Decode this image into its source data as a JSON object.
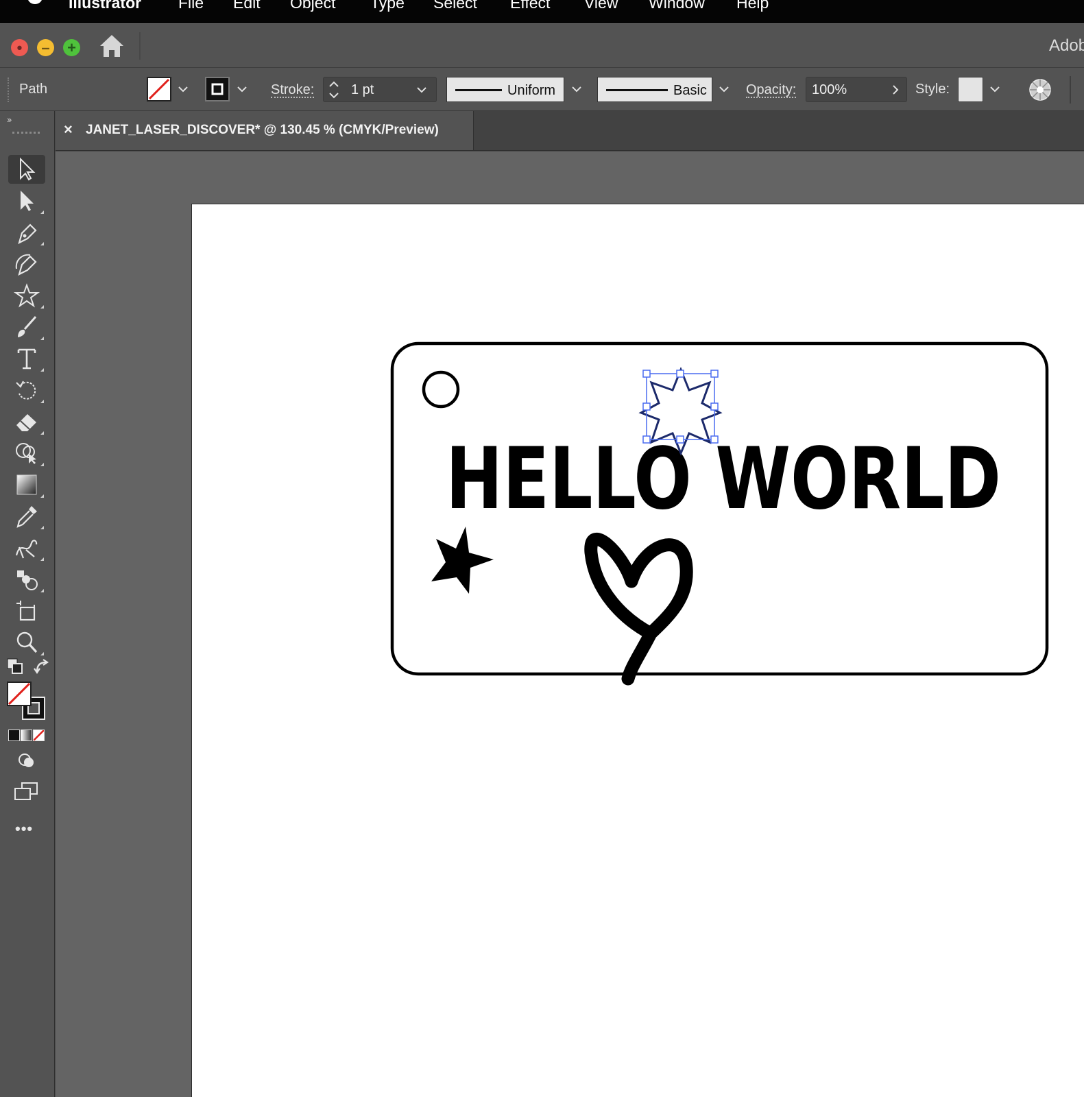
{
  "menubar": {
    "app_name": "Illustrator",
    "items": [
      "File",
      "Edit",
      "Object",
      "Type",
      "Select",
      "Effect",
      "View",
      "Window",
      "Help"
    ]
  },
  "window": {
    "app_title": "Adobe"
  },
  "controlbar": {
    "selection_label": "Path",
    "stroke_label": "Stroke:",
    "stroke_weight": "1 pt",
    "variable_width_profile": "Uniform",
    "brush_definition": "Basic",
    "opacity_label": "Opacity:",
    "opacity_value": "100%",
    "style_label": "Style:"
  },
  "document_tab": {
    "title": "JANET_LASER_DISCOVER* @ 130.45 % (CMYK/Preview)",
    "close_glyph": "×"
  },
  "toolbar": {
    "collapse_glyph": "››",
    "more_glyph": "•••",
    "tools": [
      "selection-tool",
      "direct-selection-tool",
      "pen-tool",
      "curvature-tool",
      "star-tool",
      "paintbrush-tool",
      "type-tool",
      "rotate-tool",
      "eraser-tool",
      "shape-builder-tool",
      "gradient-tool",
      "eyedropper-tool",
      "puppet-warp-tool",
      "symbol-sprayer-tool",
      "artboard-tool",
      "zoom-tool"
    ],
    "active_tool": "selection-tool"
  },
  "artwork": {
    "headline": "HELLO WORLD"
  },
  "colors": {
    "accent_selection": "#4a6cf0",
    "none_swatch_red": "#e0201b"
  }
}
